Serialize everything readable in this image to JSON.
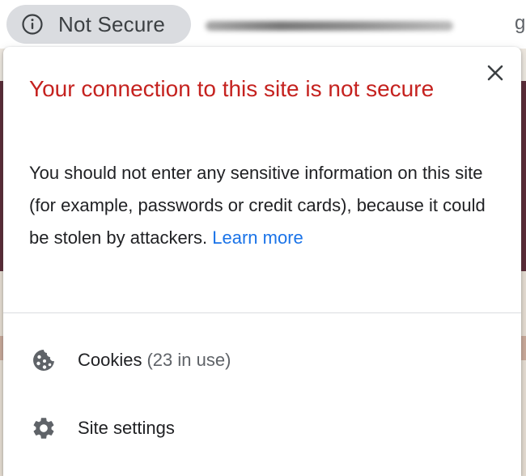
{
  "omnibox": {
    "security_label": "Not Secure",
    "security_icon": "info-icon",
    "url_obscured": true
  },
  "popup": {
    "title": "Your connection to this site is not secure",
    "body": "You should not enter any sensitive information on this site (for example, passwords or credit cards), because it could be stolen by attackers.",
    "learn_more": "Learn more",
    "close_icon": "close-icon",
    "items": [
      {
        "icon": "cookie-icon",
        "label": "Cookies",
        "detail": "(23 in use)"
      },
      {
        "icon": "gear-icon",
        "label": "Site settings"
      }
    ]
  },
  "colors": {
    "warning_title": "#c5221f",
    "link": "#1a73e8",
    "chip_bg": "#dadce0",
    "text": "#202124",
    "muted": "#5f6368"
  }
}
